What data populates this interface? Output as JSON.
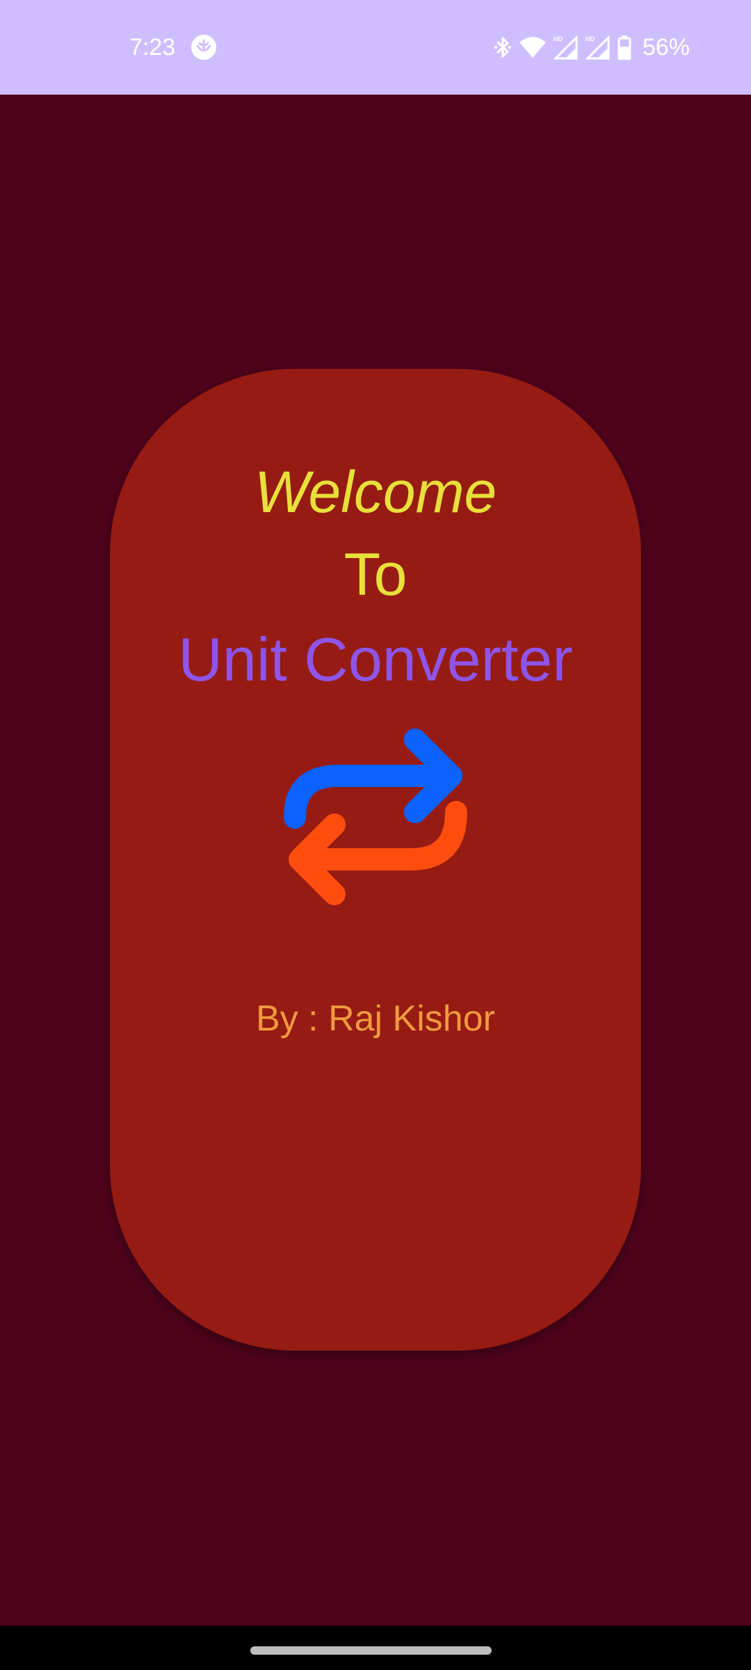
{
  "status_bar": {
    "time": "7:23",
    "battery": "56%",
    "icons": [
      "app-notification-icon",
      "bluetooth-icon",
      "wifi-icon",
      "signal-hd-icon",
      "signal-hd-icon",
      "battery-icon"
    ],
    "background": "#cfbeff"
  },
  "main": {
    "welcome": "Welcome",
    "to": "To",
    "title": "Unit Converter",
    "logo_icon": "swap-arrows-icon",
    "author": "By : Raj Kishor"
  },
  "colors": {
    "background": "#4f031b",
    "card": "#961b13",
    "welcome_text": "#e8e03a",
    "title_text": "#8e55e8",
    "author_text": "#f09a3e",
    "arrow_blue": "#0a62ff",
    "arrow_orange": "#ff4d0f"
  }
}
